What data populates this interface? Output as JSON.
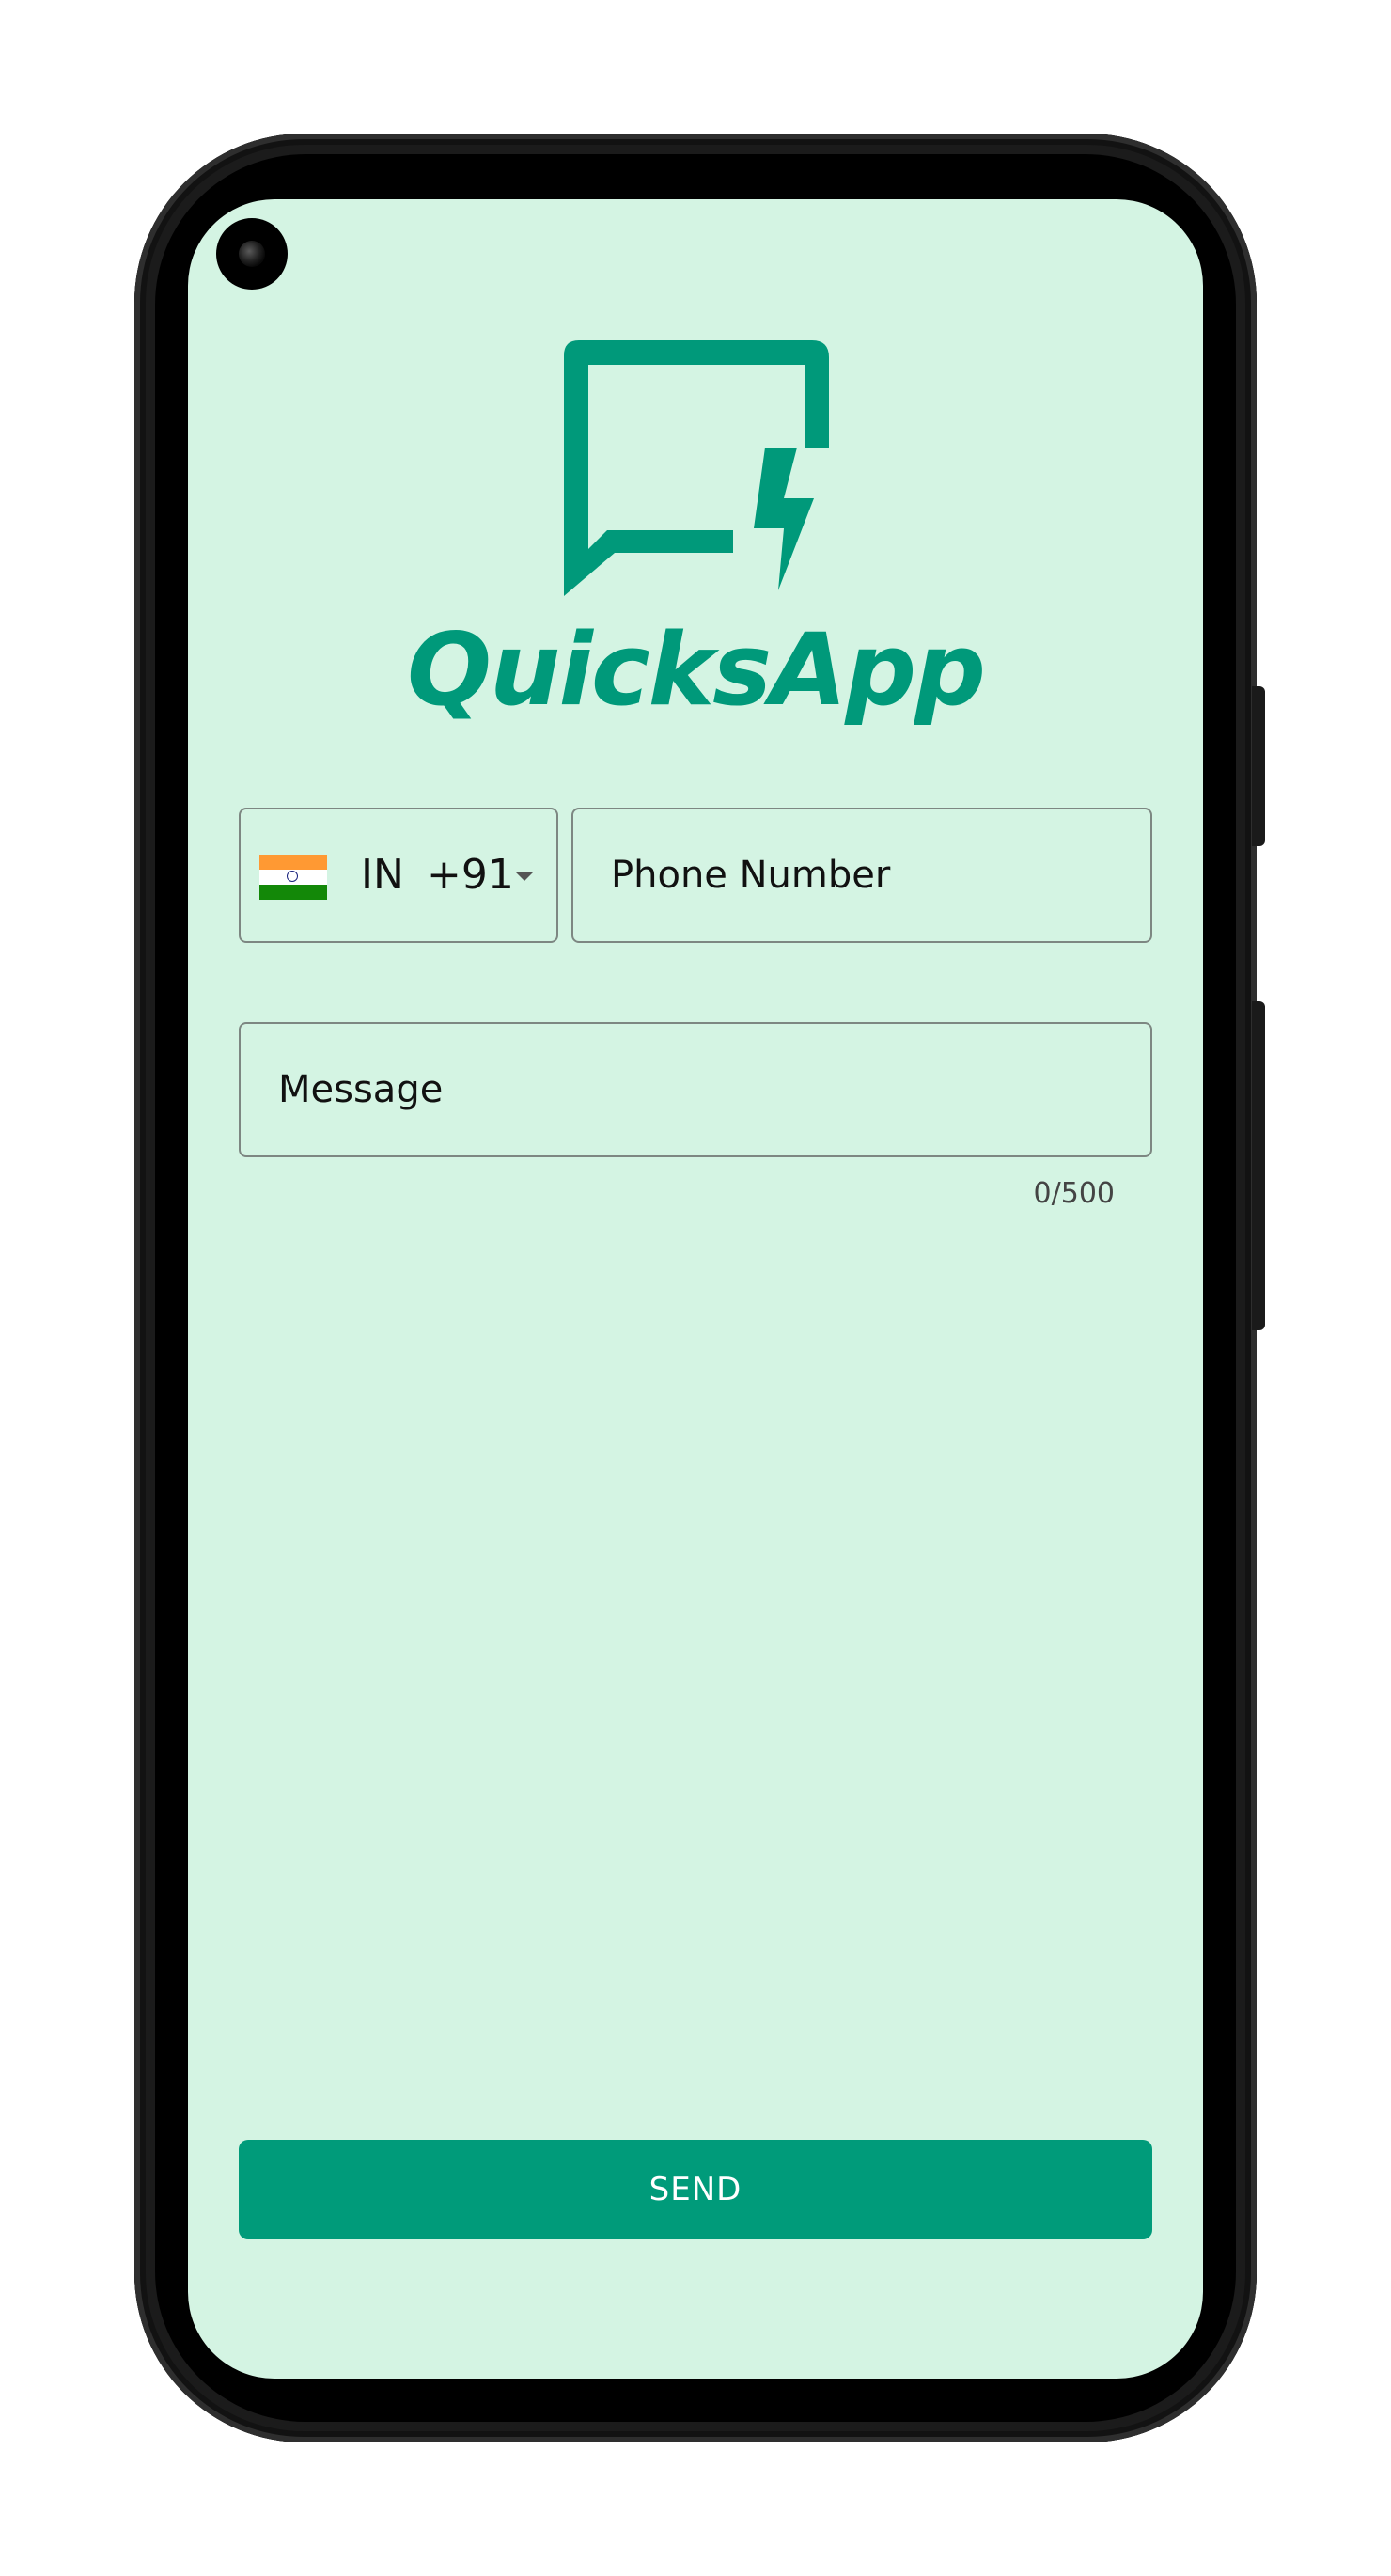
{
  "app": {
    "name": "QuicksApp",
    "accent_color": "#00997a",
    "background_color": "#d4f4e3",
    "logo_icon": "chat-bolt-icon"
  },
  "country_picker": {
    "flag_icon": "india-flag-icon",
    "country_code": "IN",
    "dial_code": "+91"
  },
  "phone": {
    "value": "",
    "placeholder": "Phone Number"
  },
  "message": {
    "value": "",
    "placeholder": "Message",
    "counter": "0/500"
  },
  "send_button": {
    "label": "SEND"
  }
}
